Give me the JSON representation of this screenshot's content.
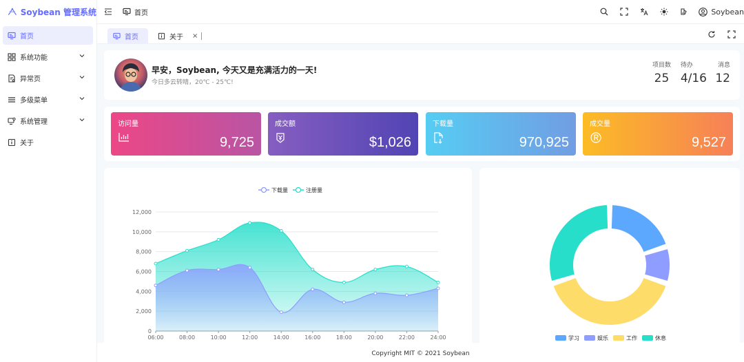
{
  "app": {
    "title": "Soybean 管理系统"
  },
  "sidebar": {
    "items": [
      {
        "label": "首页",
        "icon": "monitor-icon",
        "active": true
      },
      {
        "label": "系统功能",
        "icon": "grid-icon",
        "expandable": true
      },
      {
        "label": "异常页",
        "icon": "exception-icon",
        "expandable": true
      },
      {
        "label": "多级菜单",
        "icon": "menu-icon",
        "expandable": true
      },
      {
        "label": "系统管理",
        "icon": "settings-monitor-icon",
        "expandable": true
      },
      {
        "label": "关于",
        "icon": "info-icon"
      }
    ]
  },
  "header": {
    "breadcrumb": "首页",
    "user": "Soybean",
    "icons": [
      "search-icon",
      "fullscreen-icon",
      "translate-icon",
      "sun-icon",
      "theme-icon",
      "user-icon"
    ]
  },
  "tabs": [
    {
      "label": "首页",
      "active": true
    },
    {
      "label": "关于",
      "closable": true,
      "close_label": "×"
    }
  ],
  "welcome": {
    "greeting": "早安，Soybean, 今天又是充满活力的一天!",
    "weather": "今日多云转晴，20℃ - 25℃!",
    "stats": [
      {
        "label": "项目数",
        "value": "25"
      },
      {
        "label": "待办",
        "value": "4/16"
      },
      {
        "label": "消息",
        "value": "12"
      }
    ]
  },
  "metrics": [
    {
      "title": "访问量",
      "value": "9,725",
      "icon": "bar-chart-icon",
      "from": "#ec4786",
      "to": "#b955a4"
    },
    {
      "title": "成交额",
      "value": "$1,026",
      "icon": "yen-bag-icon",
      "from": "#865ec0",
      "to": "#5144b4"
    },
    {
      "title": "下载量",
      "value": "970,925",
      "icon": "download-file-icon",
      "from": "#56cdf3",
      "to": "#719de3"
    },
    {
      "title": "成交量",
      "value": "9,527",
      "icon": "registered-icon",
      "from": "#fcbc25",
      "to": "#f68057"
    }
  ],
  "charts": [
    {
      "type": "area",
      "legend_position": "top-center",
      "x": [
        "06:00",
        "08:00",
        "10:00",
        "12:00",
        "14:00",
        "16:00",
        "18:00",
        "20:00",
        "22:00",
        "24:00"
      ],
      "ylim": [
        0,
        12000
      ],
      "yticks": [
        "0",
        "2,000",
        "4,000",
        "6,000",
        "8,000",
        "10,000",
        "12,000"
      ],
      "grid": true,
      "series": [
        {
          "name": "下载量",
          "color": "#8e9dff",
          "values": [
            4600,
            6100,
            6200,
            6400,
            1900,
            4200,
            2900,
            3800,
            3600,
            4300
          ]
        },
        {
          "name": "注册量",
          "color": "#26deca",
          "values": [
            6800,
            8100,
            9200,
            10900,
            10100,
            6200,
            4900,
            6200,
            6500,
            4900
          ]
        }
      ]
    },
    {
      "type": "pie",
      "style": "donut",
      "legend_position": "bottom-center",
      "slices": [
        {
          "name": "学习",
          "value": 20,
          "color": "#5da8ff"
        },
        {
          "name": "娱乐",
          "value": 10,
          "color": "#8e9dff"
        },
        {
          "name": "工作",
          "value": 40,
          "color": "#fedc69"
        },
        {
          "name": "休息",
          "value": 30,
          "color": "#26deca"
        }
      ]
    }
  ],
  "footer": {
    "text": "Copyright MIT © 2021 Soybean"
  }
}
